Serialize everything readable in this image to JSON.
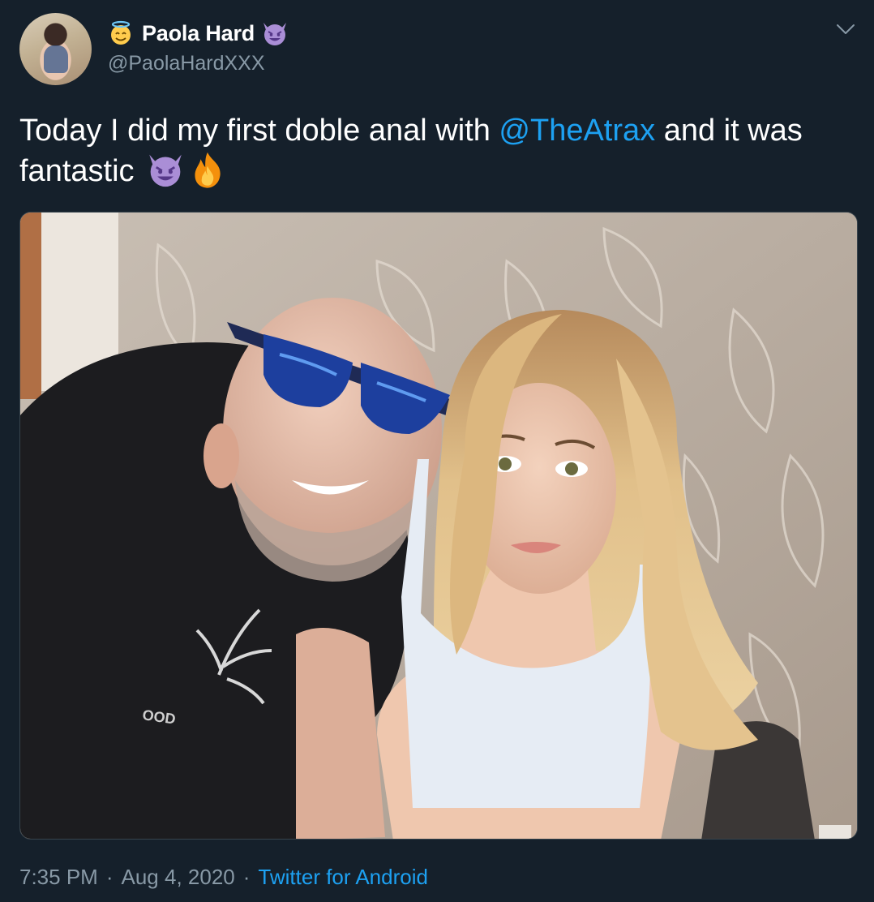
{
  "tweet": {
    "author": {
      "display_name": "Paola Hard",
      "handle": "@PaolaHardXXX",
      "name_prefix_icon": "smiling-face-with-halo-emoji",
      "name_suffix_icon": "smiling-devil-emoji"
    },
    "text": {
      "part1": "Today I did my first doble anal with ",
      "mention": "@TheAtrax",
      "part2": " and it was fantastic ",
      "trailing_icons": [
        "smiling-devil-emoji",
        "fire-emoji"
      ]
    },
    "media": {
      "type": "photo"
    },
    "footer": {
      "time": "7:35 PM",
      "separator": "·",
      "date": "Aug 4, 2020",
      "source": "Twitter for Android"
    },
    "menu_icon": "chevron-down-icon"
  },
  "colors": {
    "background": "#15202b",
    "text_primary": "#ffffff",
    "text_secondary": "#8899a6",
    "link": "#1da1f2",
    "border": "#38444d"
  }
}
